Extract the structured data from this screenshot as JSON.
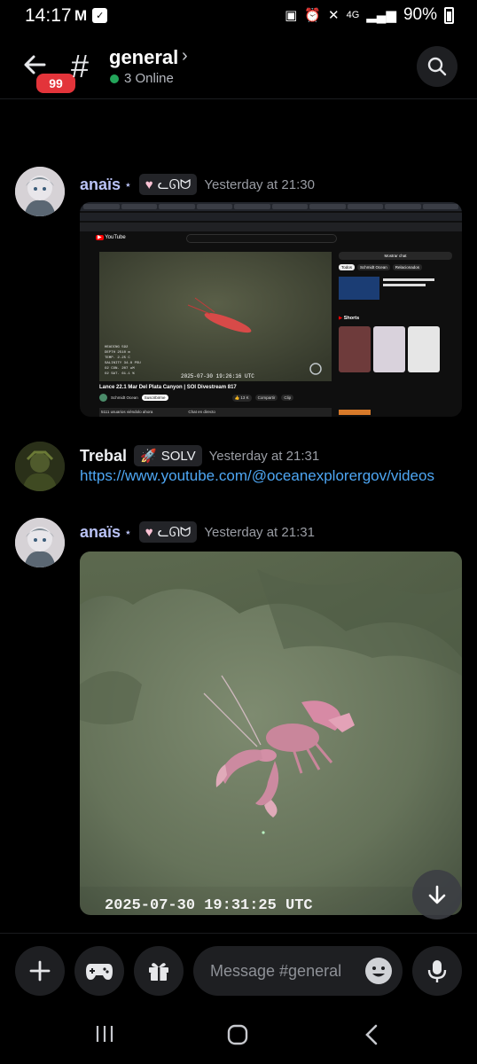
{
  "status_bar": {
    "time": "14:17",
    "network": "4G",
    "battery": "90%"
  },
  "header": {
    "unread_badge": "99",
    "channel_prefix": "#",
    "channel_name": "general",
    "online_count": "3 Online",
    "online_color": "#23a55a"
  },
  "messages": [
    {
      "author": "anaïs",
      "author_suffix": "⋆",
      "tag": "ᓚᘏᗢ",
      "timestamp": "Yesterday at 21:30",
      "attachment": {
        "type": "screenshot",
        "yt_logo": "YouTube",
        "video_title": "Lance 22.1 Mar Del Plata Canyon | SOI Divestream 817",
        "timestamp_overlay": "2025-07-30 19:26:16 UTC",
        "chat_button": "Mostrar chat",
        "filters": [
          "Todos",
          "Schmidt Ocean",
          "Relacionados"
        ],
        "shorts_label": "Shorts",
        "channel_name": "Schmidt Ocean",
        "subscribe": "Suscribirme",
        "likes": "13 K",
        "share": "Compartir",
        "clip": "Clip",
        "viewers": "5111 usuarios viéndolo ahora",
        "chat_label": "Chat en directo"
      }
    },
    {
      "author": "Trebal",
      "tag": "SOLV",
      "timestamp": "Yesterday at 21:31",
      "link": "https://www.youtube.com/@oceanexplorergov/videos"
    },
    {
      "author": "anaïs",
      "author_suffix": "⋆",
      "tag": "ᓚᘏᗢ",
      "timestamp": "Yesterday at 21:31",
      "attachment": {
        "type": "photo",
        "timestamp_overlay": "2025-07-30 19:31:25 UTC"
      }
    }
  ],
  "composer": {
    "placeholder": "Message #general"
  },
  "icons": {
    "back": "arrow-left-icon",
    "search": "search-icon",
    "add": "plus-icon",
    "games": "gamepad-icon",
    "gift": "gift-icon",
    "emoji": "emoji-icon",
    "mic": "microphone-icon",
    "scroll": "arrow-down-icon"
  }
}
